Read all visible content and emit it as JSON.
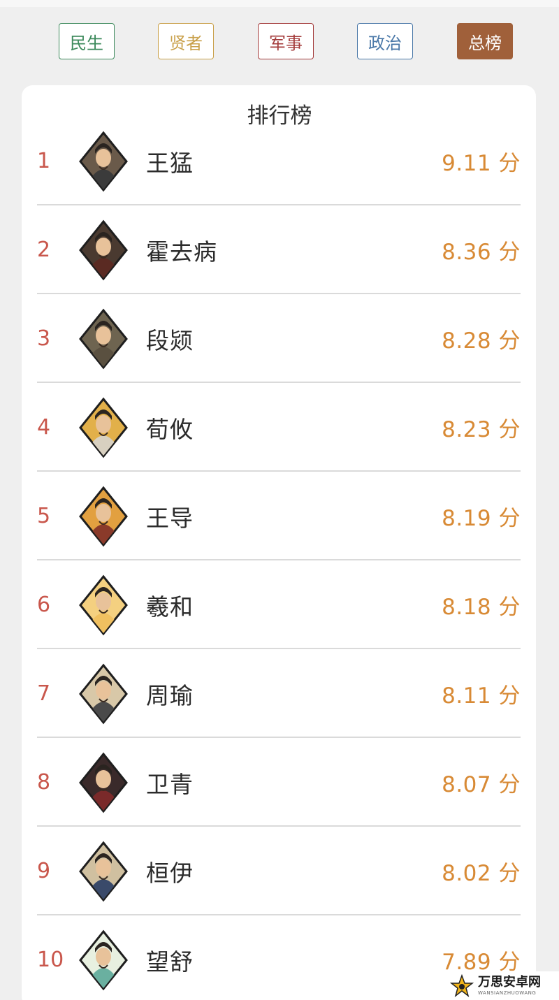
{
  "tabs": [
    {
      "label": "民生",
      "color": "#3d8a5c"
    },
    {
      "label": "贤者",
      "color": "#c9a04a"
    },
    {
      "label": "军事",
      "color": "#a33a3a"
    },
    {
      "label": "政治",
      "color": "#4a78a8"
    },
    {
      "label": "总榜",
      "color": "#a0603a",
      "active": true
    }
  ],
  "ranking": {
    "title": "排行榜",
    "entries": [
      {
        "rank": "1",
        "name": "王猛",
        "score": "9.11 分",
        "avatar_icon": "portrait-icon",
        "robe_color": "#3b3b3b",
        "bg_color": "#6a5a4a"
      },
      {
        "rank": "2",
        "name": "霍去病",
        "score": "8.36 分",
        "avatar_icon": "portrait-icon",
        "robe_color": "#5a2a22",
        "bg_color": "#4a3a30"
      },
      {
        "rank": "3",
        "name": "段颎",
        "score": "8.28 分",
        "avatar_icon": "portrait-icon",
        "robe_color": "#5a5040",
        "bg_color": "#6e6450"
      },
      {
        "rank": "4",
        "name": "荀攸",
        "score": "8.23 分",
        "avatar_icon": "portrait-icon",
        "robe_color": "#d8d0c0",
        "bg_color": "#e2b04a"
      },
      {
        "rank": "5",
        "name": "王导",
        "score": "8.19 分",
        "avatar_icon": "portrait-icon",
        "robe_color": "#8a3a2a",
        "bg_color": "#e2a040"
      },
      {
        "rank": "6",
        "name": "羲和",
        "score": "8.18 分",
        "avatar_icon": "portrait-icon",
        "robe_color": "#f0c060",
        "bg_color": "#f4d080"
      },
      {
        "rank": "7",
        "name": "周瑜",
        "score": "8.11 分",
        "avatar_icon": "portrait-icon",
        "robe_color": "#4a4a4a",
        "bg_color": "#d8c8a8"
      },
      {
        "rank": "8",
        "name": "卫青",
        "score": "8.07 分",
        "avatar_icon": "portrait-icon",
        "robe_color": "#7a2a2a",
        "bg_color": "#3a2a2a"
      },
      {
        "rank": "9",
        "name": "桓伊",
        "score": "8.02 分",
        "avatar_icon": "portrait-icon",
        "robe_color": "#3a4a6a",
        "bg_color": "#d0c0a0"
      },
      {
        "rank": "10",
        "name": "望舒",
        "score": "7.89 分",
        "avatar_icon": "portrait-icon",
        "robe_color": "#6ab0a0",
        "bg_color": "#e8f0e0"
      }
    ]
  },
  "watermark": {
    "main": "万思安卓网",
    "sub": "WANSIANZHUOWANG"
  }
}
